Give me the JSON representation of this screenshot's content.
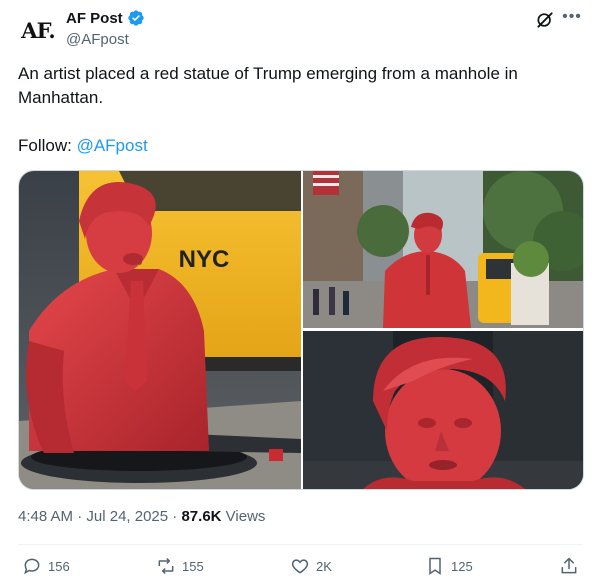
{
  "author": {
    "avatar_text": "AF.",
    "display_name": "AF Post",
    "handle": "@AFpost"
  },
  "tweet": {
    "text": "An artist placed a red statue of Trump emerging from a manhole in Manhattan.",
    "follow_prefix": "Follow: ",
    "follow_mention": "@AFpost"
  },
  "media": {
    "taxi_lettering": "NYC"
  },
  "meta": {
    "time": "4:48 AM",
    "separator1": " · ",
    "date": "Jul 24, 2025",
    "separator2": " · ",
    "views_count": "87.6K",
    "views_label": " Views"
  },
  "actions": {
    "replies": "156",
    "reposts": "155",
    "likes": "2K",
    "bookmarks": "125"
  },
  "colors": {
    "accent": "#1d9bf0",
    "secondary_text": "#536471",
    "statue_red": "#d8373c",
    "taxi_yellow": "#f2b31b"
  },
  "icons": [
    "verified-badge-icon",
    "grok-icon",
    "more-icon",
    "reply-icon",
    "repost-icon",
    "like-icon",
    "bookmark-icon",
    "share-icon"
  ]
}
